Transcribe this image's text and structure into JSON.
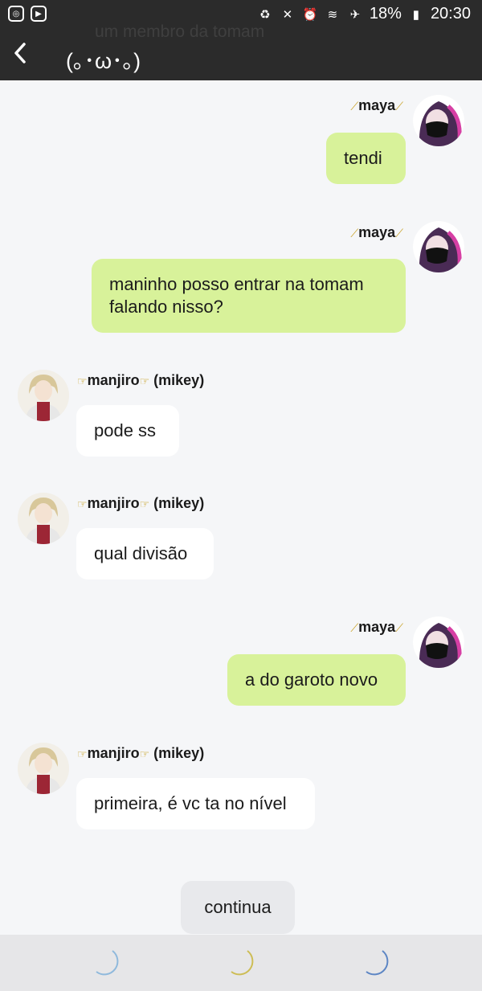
{
  "header": {
    "subtitle": "um membro da tomam",
    "title": "(｡･ω･｡)"
  },
  "status_bar": {
    "battery": "18%",
    "time": "20:30",
    "left_icons": [
      "instagram-icon",
      "play-store-icon"
    ],
    "right_icons": [
      "battery-saver-icon",
      "mute-icon",
      "alarm-icon",
      "wifi-icon",
      "airplane-icon",
      "battery-icon"
    ]
  },
  "messages": [
    {
      "side": "out",
      "author": "maya",
      "text": "tendi"
    },
    {
      "side": "out",
      "author": "maya",
      "text": "maninho posso entrar na tomam falando nisso?"
    },
    {
      "side": "in",
      "author": "manjiro",
      "author_suffix": "(mikey)",
      "text": "pode ss"
    },
    {
      "side": "in",
      "author": "manjiro",
      "author_suffix": "(mikey)",
      "text": "qual divisão"
    },
    {
      "side": "out",
      "author": "maya",
      "text": "a do garoto novo"
    },
    {
      "side": "in",
      "author": "manjiro",
      "author_suffix": "(mikey)",
      "text": "primeira, é vc ta no nível"
    }
  ],
  "continue_label": "continua",
  "bottom_icons": [
    "moon-icon-blue",
    "moon-icon-yellow",
    "moon-icon-navy"
  ],
  "colors": {
    "header_bg": "#2b2b2b",
    "outgoing_bubble": "#d8f29a",
    "incoming_bubble": "#ffffff",
    "chat_bg": "#f5f6f8"
  }
}
